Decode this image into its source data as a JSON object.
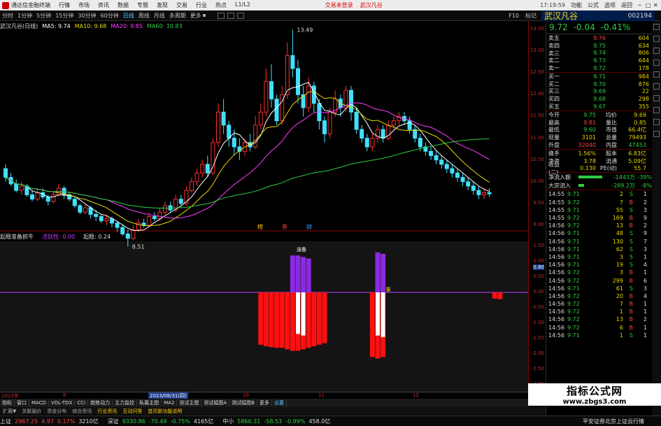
{
  "titlebar": {
    "app_title": "通达信金融终端",
    "menu": [
      "行情",
      "市场",
      "资讯",
      "数据",
      "专题",
      "发现",
      "交易",
      "行业",
      "热点",
      "L1/L2"
    ],
    "promo_1": "交易未登录",
    "promo_2": "武汉凡谷",
    "right_menu": [
      "功能",
      "公式",
      "选项",
      "返回"
    ],
    "time": "17:19:59",
    "window_buttons": [
      "─",
      "□",
      "✕"
    ]
  },
  "toolbar": {
    "periods": [
      "分时",
      "1分钟",
      "5分钟",
      "15分钟",
      "30分钟",
      "60分钟",
      "日线",
      "周线",
      "月线",
      "多周期",
      "更多"
    ],
    "active_period": "日线",
    "stock_name": "武汉凡谷",
    "stock_code": "002194",
    "right_buttons": [
      "F10",
      "标记"
    ]
  },
  "ma_line": {
    "name": "武汉凡谷(日线)",
    "ma5": "MA5: 9.74",
    "ma10": "MA10: 9.68",
    "ma20": "MA20: 9.85",
    "ma60": "MA60: 10.83"
  },
  "indicator_header": {
    "name": "起稳准备抓牛",
    "param1": "活跃性: 0.00",
    "param2": "起稳: 0.24"
  },
  "chart_data": {
    "type": "candlestick",
    "price_axis": [
      "13.50",
      "13.00",
      "12.50",
      "12.00",
      "11.50",
      "11.00",
      "10.50",
      "10.00",
      "9.50",
      "9.00"
    ],
    "ind_axis": [
      "1.50",
      "1.00",
      "0.50",
      "0.00",
      "-0.50",
      "-1.00",
      "-1.50",
      "-2.00",
      "-2.50",
      "-3.00"
    ],
    "high_label": "13.49",
    "low_label": "8.51",
    "ind_current": "0.80",
    "markers": [
      "榜",
      "券",
      "财"
    ],
    "ind_labels": [
      "涨备",
      "量"
    ],
    "dates": [
      "2023年",
      "8",
      "2023/08/31(四)",
      "10",
      "11",
      "12"
    ],
    "candles": [
      [
        10.3,
        10.1,
        10.4,
        10.0
      ],
      [
        10.1,
        9.95,
        10.2,
        9.9
      ],
      [
        9.95,
        9.8,
        10.05,
        9.75
      ],
      [
        9.8,
        9.9,
        10.0,
        9.7
      ],
      [
        9.9,
        9.7,
        9.95,
        9.65
      ],
      [
        9.7,
        9.6,
        9.8,
        9.55
      ],
      [
        9.6,
        9.75,
        9.85,
        9.55
      ],
      [
        9.75,
        9.65,
        9.85,
        9.6
      ],
      [
        9.65,
        9.55,
        9.7,
        9.45
      ],
      [
        9.55,
        9.7,
        9.8,
        9.5
      ],
      [
        9.7,
        9.85,
        9.95,
        9.65
      ],
      [
        9.85,
        9.7,
        9.9,
        9.6
      ],
      [
        9.7,
        9.6,
        9.75,
        9.55
      ],
      [
        9.6,
        9.45,
        9.65,
        9.4
      ],
      [
        9.45,
        9.3,
        9.5,
        9.25
      ],
      [
        9.3,
        9.4,
        9.5,
        9.25
      ],
      [
        9.4,
        9.25,
        9.45,
        9.15
      ],
      [
        9.25,
        9.2,
        9.35,
        9.1
      ],
      [
        9.2,
        9.1,
        9.25,
        9.05
      ],
      [
        9.1,
        9.15,
        9.25,
        9.0
      ],
      [
        9.15,
        9.05,
        9.2,
        8.95
      ],
      [
        9.05,
        8.95,
        9.1,
        8.85
      ],
      [
        8.95,
        8.8,
        9.0,
        8.75
      ],
      [
        8.8,
        8.7,
        8.9,
        8.51
      ],
      [
        8.7,
        8.9,
        9.0,
        8.65
      ],
      [
        8.9,
        9.05,
        9.15,
        8.85
      ],
      [
        9.05,
        9.0,
        9.15,
        8.95
      ],
      [
        9.0,
        9.2,
        9.3,
        8.95
      ],
      [
        9.2,
        9.15,
        9.3,
        9.1
      ],
      [
        9.15,
        9.3,
        9.4,
        9.1
      ],
      [
        9.3,
        9.45,
        9.55,
        9.25
      ],
      [
        9.45,
        9.35,
        9.55,
        9.3
      ],
      [
        9.35,
        9.6,
        9.7,
        9.3
      ],
      [
        9.6,
        9.5,
        9.7,
        9.45
      ],
      [
        9.5,
        9.8,
        9.9,
        9.45
      ],
      [
        9.8,
        10.0,
        10.1,
        9.75
      ],
      [
        10.0,
        10.2,
        10.3,
        9.9
      ],
      [
        10.2,
        10.4,
        10.5,
        10.1
      ],
      [
        10.4,
        10.2,
        10.6,
        10.1
      ],
      [
        10.2,
        10.9,
        11.0,
        10.15
      ],
      [
        10.9,
        11.6,
        11.8,
        10.8
      ],
      [
        11.6,
        11.3,
        11.9,
        11.1
      ],
      [
        11.3,
        11.0,
        11.4,
        10.8
      ],
      [
        11.0,
        10.8,
        11.2,
        10.6
      ],
      [
        10.8,
        10.7,
        11.0,
        10.5
      ],
      [
        10.7,
        10.9,
        11.0,
        10.6
      ],
      [
        10.9,
        10.8,
        11.1,
        10.7
      ],
      [
        10.8,
        11.3,
        11.5,
        10.75
      ],
      [
        11.3,
        11.6,
        11.8,
        11.2
      ],
      [
        11.6,
        12.3,
        12.6,
        11.5
      ],
      [
        12.3,
        11.9,
        12.7,
        11.7
      ],
      [
        11.9,
        11.4,
        12.0,
        11.3
      ],
      [
        11.4,
        12.0,
        12.2,
        11.3
      ],
      [
        12.0,
        12.9,
        13.2,
        11.9
      ],
      [
        12.9,
        12.6,
        13.49,
        12.4
      ],
      [
        12.6,
        12.0,
        12.8,
        11.8
      ],
      [
        12.0,
        11.7,
        12.2,
        11.5
      ],
      [
        11.7,
        12.2,
        12.4,
        11.6
      ],
      [
        12.2,
        11.8,
        12.3,
        11.6
      ],
      [
        11.8,
        11.4,
        11.9,
        11.2
      ],
      [
        11.4,
        11.1,
        11.5,
        10.9
      ],
      [
        11.1,
        11.6,
        11.7,
        11.0
      ],
      [
        11.6,
        11.9,
        12.1,
        11.5
      ],
      [
        11.9,
        11.7,
        12.0,
        11.5
      ],
      [
        11.7,
        12.1,
        12.2,
        11.6
      ],
      [
        12.1,
        11.6,
        12.2,
        11.4
      ],
      [
        11.6,
        11.2,
        11.7,
        11.1
      ],
      [
        11.2,
        11.0,
        11.3,
        10.9
      ],
      [
        11.0,
        10.8,
        11.1,
        10.7
      ],
      [
        10.8,
        11.0,
        11.1,
        10.7
      ],
      [
        11.0,
        11.2,
        11.3,
        10.9
      ],
      [
        11.2,
        11.0,
        11.3,
        10.9
      ],
      [
        11.0,
        11.3,
        11.4,
        10.95
      ],
      [
        11.3,
        11.4,
        11.5,
        11.2
      ],
      [
        11.4,
        11.5,
        11.6,
        11.3
      ],
      [
        11.5,
        11.4,
        11.6,
        11.3
      ],
      [
        11.4,
        11.2,
        11.5,
        11.1
      ],
      [
        11.2,
        11.0,
        11.3,
        10.9
      ],
      [
        11.0,
        10.8,
        11.1,
        10.7
      ],
      [
        10.8,
        10.7,
        10.9,
        10.6
      ],
      [
        10.7,
        10.6,
        10.8,
        10.5
      ],
      [
        10.6,
        10.5,
        10.7,
        10.4
      ],
      [
        10.5,
        10.4,
        10.6,
        10.3
      ],
      [
        10.4,
        10.3,
        10.5,
        10.2
      ],
      [
        10.3,
        10.2,
        10.4,
        10.1
      ],
      [
        10.2,
        10.1,
        10.3,
        10.0
      ],
      [
        10.1,
        10.0,
        10.2,
        9.9
      ],
      [
        10.0,
        9.9,
        10.1,
        9.8
      ],
      [
        9.9,
        9.8,
        10.0,
        9.7
      ],
      [
        9.8,
        9.7,
        9.9,
        9.6
      ],
      [
        9.7,
        9.75,
        9.85,
        9.6
      ],
      [
        9.75,
        9.72,
        9.85,
        9.65
      ]
    ],
    "ind_bars_down": [
      [
        48,
        -1.7
      ],
      [
        49,
        -1.75
      ],
      [
        50,
        -1.78
      ],
      [
        51,
        -1.8
      ],
      [
        52,
        -1.8
      ],
      [
        53,
        -1.85
      ],
      [
        54,
        -1.9
      ],
      [
        55,
        -1.9
      ],
      [
        56,
        -1.85
      ],
      [
        57,
        -1.8
      ],
      [
        58,
        -1.75
      ],
      [
        59,
        -1.7
      ],
      [
        60,
        -1.65
      ],
      [
        69,
        -2.1
      ],
      [
        70,
        -2.15
      ],
      [
        71,
        -2.1
      ],
      [
        92,
        -0.2
      ],
      [
        93,
        -0.22
      ]
    ],
    "ind_bars_up": [
      [
        54,
        1.2
      ],
      [
        55,
        1.2
      ],
      [
        56,
        1.15
      ],
      [
        57,
        1.1
      ],
      [
        70,
        1.3
      ],
      [
        71,
        1.25
      ]
    ],
    "ind_white": [
      [
        55,
        -1.35
      ],
      [
        56,
        -1.4
      ],
      [
        70,
        -1.4
      ],
      [
        71,
        -1.45
      ]
    ]
  },
  "quote": {
    "price": "9.72",
    "change": "-0.04",
    "pct": "-0.41%",
    "asks": [
      {
        "label": "卖五",
        "price": "9.76",
        "vol": "604"
      },
      {
        "label": "卖四",
        "price": "9.75",
        "vol": "634"
      },
      {
        "label": "卖三",
        "price": "9.74",
        "vol": "806"
      },
      {
        "label": "卖二",
        "price": "9.73",
        "vol": "644"
      },
      {
        "label": "卖一",
        "price": "9.72",
        "vol": "178"
      }
    ],
    "bids": [
      {
        "label": "买一",
        "price": "9.71",
        "vol": "984"
      },
      {
        "label": "买二",
        "price": "9.70",
        "vol": "876"
      },
      {
        "label": "买三",
        "price": "9.69",
        "vol": "22"
      },
      {
        "label": "买四",
        "price": "9.68",
        "vol": "298"
      },
      {
        "label": "买五",
        "price": "9.67",
        "vol": "355"
      }
    ],
    "stats": [
      {
        "l1": "今开",
        "v1": "9.75",
        "l2": "均价",
        "v2": "9.69"
      },
      {
        "l1": "最高",
        "v1": "9.81",
        "l2": "量比",
        "v2": "0.85"
      },
      {
        "l1": "最低",
        "v1": "9.60",
        "l2": "市值",
        "v2": "66.4亿"
      },
      {
        "l1": "现量",
        "v1": "3101",
        "l2": "总量",
        "v2": "79493"
      },
      {
        "l1": "外盘",
        "v1": "32040",
        "l2": "内盘",
        "v2": "47453"
      }
    ],
    "stats2": [
      {
        "l1": "换手",
        "v1": "1.56%",
        "l2": "股本",
        "v2": "6.83亿"
      },
      {
        "l1": "净资",
        "v1": "3.78",
        "l2": "流通",
        "v2": "5.09亿"
      },
      {
        "l1": "收益(二)",
        "v1": "0.130",
        "l2": "PE(动)",
        "v2": "55.7"
      }
    ],
    "flows": [
      {
        "label": "净流入额",
        "val": "-1443万",
        "pct": "-39%"
      },
      {
        "label": "大宗流入",
        "val": "-289.2万",
        "pct": "-8%"
      }
    ],
    "ticks": [
      {
        "t": "14:55",
        "p": "9.71",
        "v": "2",
        "s": "S",
        "n": "1"
      },
      {
        "t": "14:55",
        "p": "9.72",
        "v": "7",
        "s": "B",
        "n": "2"
      },
      {
        "t": "14:55",
        "p": "9.71",
        "v": "55",
        "s": "S",
        "n": "3"
      },
      {
        "t": "14:55",
        "p": "9.72",
        "v": "169",
        "s": "B",
        "n": "9"
      },
      {
        "t": "14:56",
        "p": "9.72",
        "v": "13",
        "s": "B",
        "n": "2"
      },
      {
        "t": "14:56",
        "p": "9.71",
        "v": "48",
        "s": "S",
        "n": "9"
      },
      {
        "t": "14:56",
        "p": "9.71",
        "v": "130",
        "s": "S",
        "n": "7"
      },
      {
        "t": "14:56",
        "p": "9.71",
        "v": "62",
        "s": "S",
        "n": "3"
      },
      {
        "t": "14:56",
        "p": "9.71",
        "v": "3",
        "s": "S",
        "n": "1"
      },
      {
        "t": "14:56",
        "p": "9.71",
        "v": "19",
        "s": "S",
        "n": "4"
      },
      {
        "t": "14:56",
        "p": "9.72",
        "v": "3",
        "s": "B",
        "n": "1"
      },
      {
        "t": "14:56",
        "p": "9.72",
        "v": "299",
        "s": "B",
        "n": "6"
      },
      {
        "t": "14:56",
        "p": "9.71",
        "v": "61",
        "s": "S",
        "n": "3"
      },
      {
        "t": "14:56",
        "p": "9.72",
        "v": "20",
        "s": "B",
        "n": "4"
      },
      {
        "t": "14:56",
        "p": "9.72",
        "v": "7",
        "s": "B",
        "n": "1"
      },
      {
        "t": "14:56",
        "p": "9.72",
        "v": "1",
        "s": "B",
        "n": "1"
      },
      {
        "t": "14:56",
        "p": "9.72",
        "v": "13",
        "s": "B",
        "n": "2"
      },
      {
        "t": "14:56",
        "p": "9.72",
        "v": "6",
        "s": "B",
        "n": "1"
      },
      {
        "t": "14:56",
        "p": "9.71",
        "v": "1",
        "s": "S",
        "n": "1"
      }
    ]
  },
  "tabs": [
    "指标",
    "窗口",
    "MACD",
    "VOL-TDX",
    "CCI",
    "趋势动力",
    "主力监控",
    "私募主图",
    "MA2",
    "测试主图",
    "测试幅图A",
    "测试幅图B",
    "更多",
    "设置"
  ],
  "active_tab": "设置",
  "subtabs": [
    "扩展▼",
    "关联报价",
    "资金分布",
    "综合资讯",
    "行业资讯",
    "互动问答",
    "首页新功能说明"
  ],
  "index_bar": [
    {
      "lab": "上证",
      "v1": "2967.25",
      "v2": "4.97",
      "v3": "0.17%",
      "v4": "3210亿",
      "dir": "up"
    },
    {
      "lab": "深证",
      "v1": "9330.86",
      "v2": "-70.49",
      "v3": "-0.75%",
      "v4": "4165亿",
      "dir": "dn"
    },
    {
      "lab": "中小",
      "v1": "5866.31",
      "v2": "-58.53",
      "v3": "-0.99%",
      "v4": "458.0亿",
      "dir": "dn"
    }
  ],
  "broker": "平安证券北京上证云行情",
  "watermark": {
    "line1": "指标公式网",
    "line2": "www.zbgs3.com"
  },
  "colors": {
    "up": "#ff4040",
    "down": "#2ecc40",
    "ma5": "#ffffff",
    "ma10": "#e6d800",
    "ma20": "#ff3cff",
    "ma60": "#2ecc40",
    "ind_line": "#c040ff"
  }
}
